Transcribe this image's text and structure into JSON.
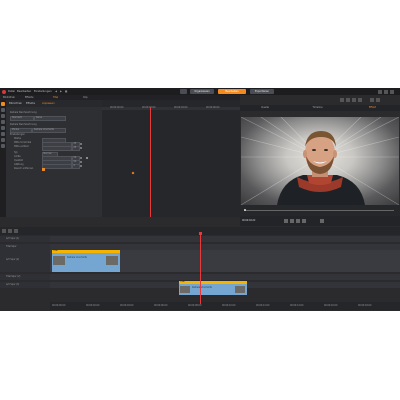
{
  "colors": {
    "accent": "#f58b1f",
    "clip_title": "#f5b400",
    "clip_video": "#74a6d1",
    "playhead": "#e83a3a",
    "bg": "#2b2b2e"
  },
  "menu": {
    "items": [
      "Datei",
      "Bearbeiten",
      "Einstellungen"
    ],
    "mode_buttons": [
      "Organisieren",
      "Bearbeiten",
      "Exportieren"
    ],
    "active_mode": "Bearbeiten"
  },
  "tabs": [
    "Bibliothek",
    "Effekte",
    "Titel",
    "Clip"
  ],
  "panel": {
    "tabs": [
      "Bibliothek",
      "Effekte",
      "Anpassen"
    ],
    "section1": "Radiale Weichzeichnung",
    "preset_label": "Standard",
    "preset_value": "Keine",
    "section2": "Radiale Weichzeichnung",
    "mode_label": "Modus",
    "mode_value": "Radiale Unschärfe",
    "params_header": "Einstellungen",
    "params": [
      "Stärke",
      "Mitte horizontal",
      "Mitte vertikal",
      "Typ",
      "Größe",
      "Qualität",
      "Glättung",
      "Rausch entfernen"
    ],
    "values": [
      "",
      "25",
      "25",
      "Normal",
      "50",
      "50",
      "0",
      ""
    ]
  },
  "preview": {
    "tabs": [
      "Quelle",
      "Timeline",
      "Effekt"
    ],
    "active": "Effekt",
    "timecode": "00:00:04:22",
    "icons": [
      "play-icon",
      "pause-icon",
      "stop-icon",
      "loop-icon",
      "volume-icon"
    ]
  },
  "timeline": {
    "tracks": [
      {
        "name": "A/V Spur (1)"
      },
      {
        "name": "Titel-Spur"
      },
      {
        "name": "A/V Spur (2)"
      },
      {
        "name": "Titel-Spur (2)"
      },
      {
        "name": "A/V Spur (3)"
      }
    ],
    "clips": [
      {
        "title": "Titel",
        "label": "Radiale Unschärfe"
      },
      {
        "title": "Titel",
        "label": "Radiale Unschärfe"
      }
    ],
    "ruler": [
      "00:00:00:00",
      "00:00:02:00",
      "00:00:04:00",
      "00:00:06:00",
      "00:00:08:00",
      "00:00:10:00",
      "00:00:12:00",
      "00:00:14:00",
      "00:00:16:00",
      "00:00:18:00"
    ]
  }
}
